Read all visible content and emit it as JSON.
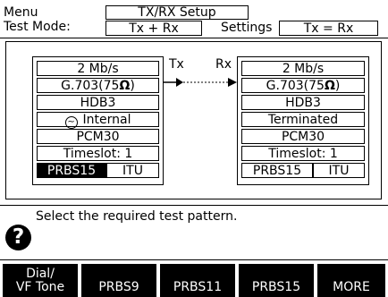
{
  "header": {
    "menu_label": "Menu",
    "menu_value": "TX/RX Setup",
    "mode_label": "Test Mode:",
    "mode_value": "Tx + Rx",
    "settings_label": "Settings",
    "settings_value": "Tx = Rx"
  },
  "tx_panel": {
    "side_label": "Tx",
    "rate": "2 Mb/s",
    "interface_prefix": "G.703(75",
    "interface_omega": "Ω",
    "interface_suffix": ")",
    "code": "HDB3",
    "clock_icon": "~",
    "clock": "Internal",
    "framing": "PCM30",
    "timeslot": "Timeslot: 1",
    "pattern_selected": "PRBS15",
    "pattern_standard": "ITU"
  },
  "rx_panel": {
    "side_label": "Rx",
    "rate": "2 Mb/s",
    "interface_prefix": "G.703(75",
    "interface_omega": "Ω",
    "interface_suffix": ")",
    "code": "HDB3",
    "termination": "Terminated",
    "framing": "PCM30",
    "timeslot": "Timeslot: 1",
    "pattern": "PRBS15",
    "pattern_standard": "ITU"
  },
  "help": {
    "icon": "?",
    "text": "Select the required test pattern."
  },
  "softkeys": [
    {
      "line1": "Dial/",
      "line2": "VF Tone"
    },
    {
      "line1": "",
      "line2": "PRBS9"
    },
    {
      "line1": "",
      "line2": "PRBS11"
    },
    {
      "line1": "",
      "line2": "PRBS15"
    },
    {
      "line1": "",
      "line2": "MORE"
    }
  ]
}
